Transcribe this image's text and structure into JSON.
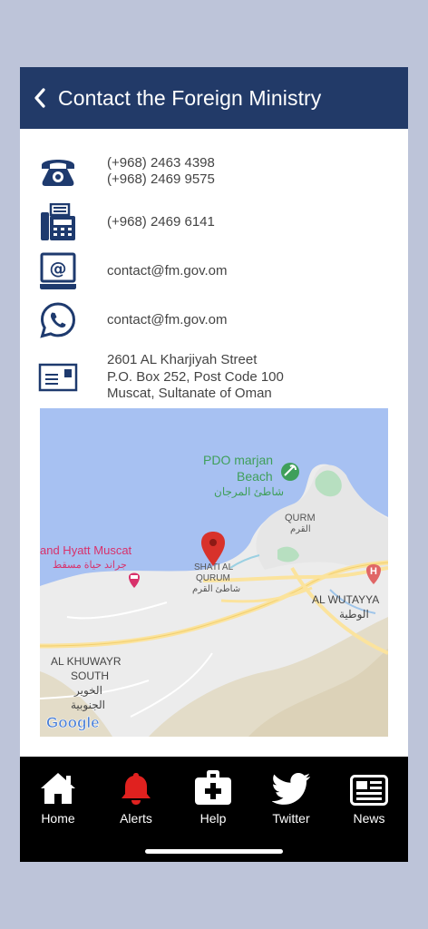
{
  "header": {
    "title": "Contact the Foreign Ministry"
  },
  "contacts": {
    "phone_1": "(+968) 2463 4398",
    "phone_2": "(+968) 2469 9575",
    "fax": "(+968) 2469 6141",
    "email": "contact@fm.gov.om",
    "whatsapp": "contact@fm.gov.om",
    "address_1": "2601 AL Kharjiyah Street",
    "address_2": "P.O. Box 252, Post Code 100",
    "address_3": "Muscat, Sultanate of Oman"
  },
  "map": {
    "labels": {
      "pdo_en_1": "PDO marjan",
      "pdo_en_2": "Beach",
      "pdo_ar": "شاطئ المرجان",
      "qurm_en": "QURM",
      "qurm_ar": "القرم",
      "hyatt_en": "and Hyatt Muscat",
      "hyatt_ar": "جراند حياة مسقط",
      "shati_en_1": "SHATI AL",
      "shati_en_2": "QURUM",
      "shati_ar": "شاطئ القرم",
      "wutayyah_en": "AL WUTAYYA",
      "wutayyah_ar": "الوطية",
      "khuwayr_en_1": "AL KHUWAYR",
      "khuwayr_en_2": "SOUTH",
      "khuwayr_ar_1": "الخوير",
      "khuwayr_ar_2": "الجنوبية",
      "google": "Google"
    },
    "colors": {
      "water": "#a7c1f2",
      "land": "#ececec",
      "road": "#fbe39d",
      "pin": "#d8322b"
    }
  },
  "tabs": [
    {
      "label": "Home",
      "icon": "home-icon"
    },
    {
      "label": "Alerts",
      "icon": "bell-icon"
    },
    {
      "label": "Help",
      "icon": "first-aid-icon"
    },
    {
      "label": "Twitter",
      "icon": "twitter-icon"
    },
    {
      "label": "News",
      "icon": "newspaper-icon"
    }
  ],
  "colors": {
    "header": "#223a68",
    "icon_navy": "#1e3a6e",
    "alert_red": "#e0211f",
    "background": "#bdc4d9"
  }
}
